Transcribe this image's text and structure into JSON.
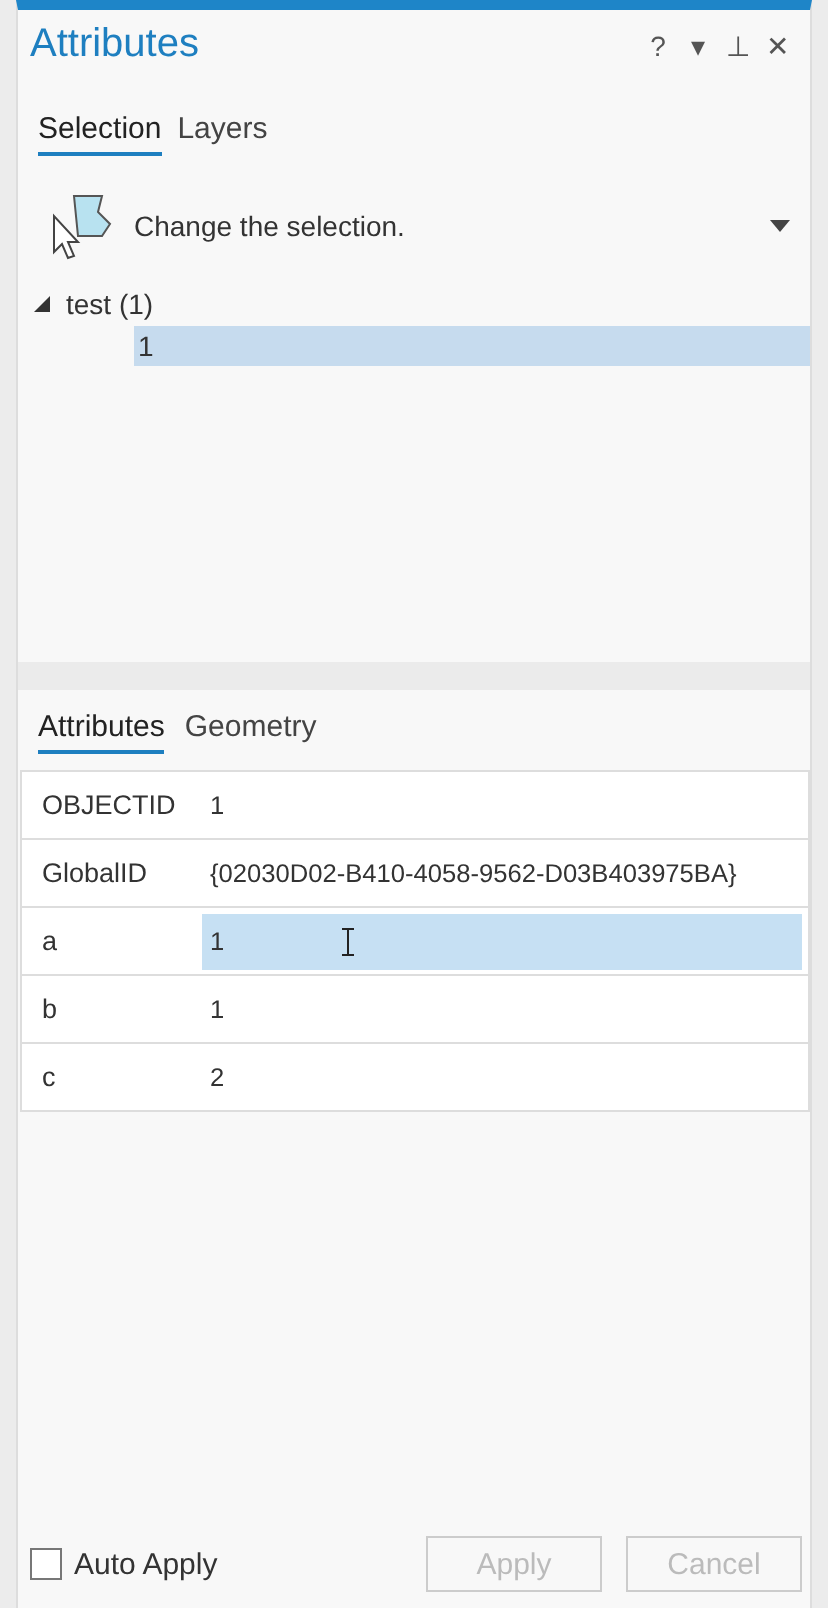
{
  "window": {
    "title": "Attributes",
    "controls": [
      "?",
      "▾",
      "⊥",
      "✕"
    ]
  },
  "tabs": [
    {
      "label": "Selection",
      "selected": true
    },
    {
      "label": "Layers",
      "selected": false
    }
  ],
  "tool": {
    "label": "Change the selection."
  },
  "tree": [
    {
      "label": "test (1)",
      "expanded": true,
      "selected": false,
      "children": [
        {
          "label": "1",
          "selected": true
        }
      ]
    }
  ],
  "detail_tabs": [
    {
      "label": "Attributes",
      "selected": true
    },
    {
      "label": "Geometry",
      "selected": false
    }
  ],
  "table": {
    "rows": [
      {
        "field": "OBJECTID",
        "value": "1",
        "selected": false
      },
      {
        "field": "GlobalID",
        "value": "{02030D02-B410-4058-9562-D03B403975BA}",
        "selected": false
      },
      {
        "field": "a",
        "value": "1",
        "selected": true
      },
      {
        "field": "b",
        "value": "1",
        "selected": false
      },
      {
        "field": "c",
        "value": "2",
        "selected": false
      }
    ]
  },
  "footer": {
    "auto_apply": {
      "label": "Auto Apply",
      "checked": false
    },
    "buttons": [
      {
        "label": "Apply",
        "disabled": true
      },
      {
        "label": "Cancel",
        "disabled": true
      }
    ]
  }
}
